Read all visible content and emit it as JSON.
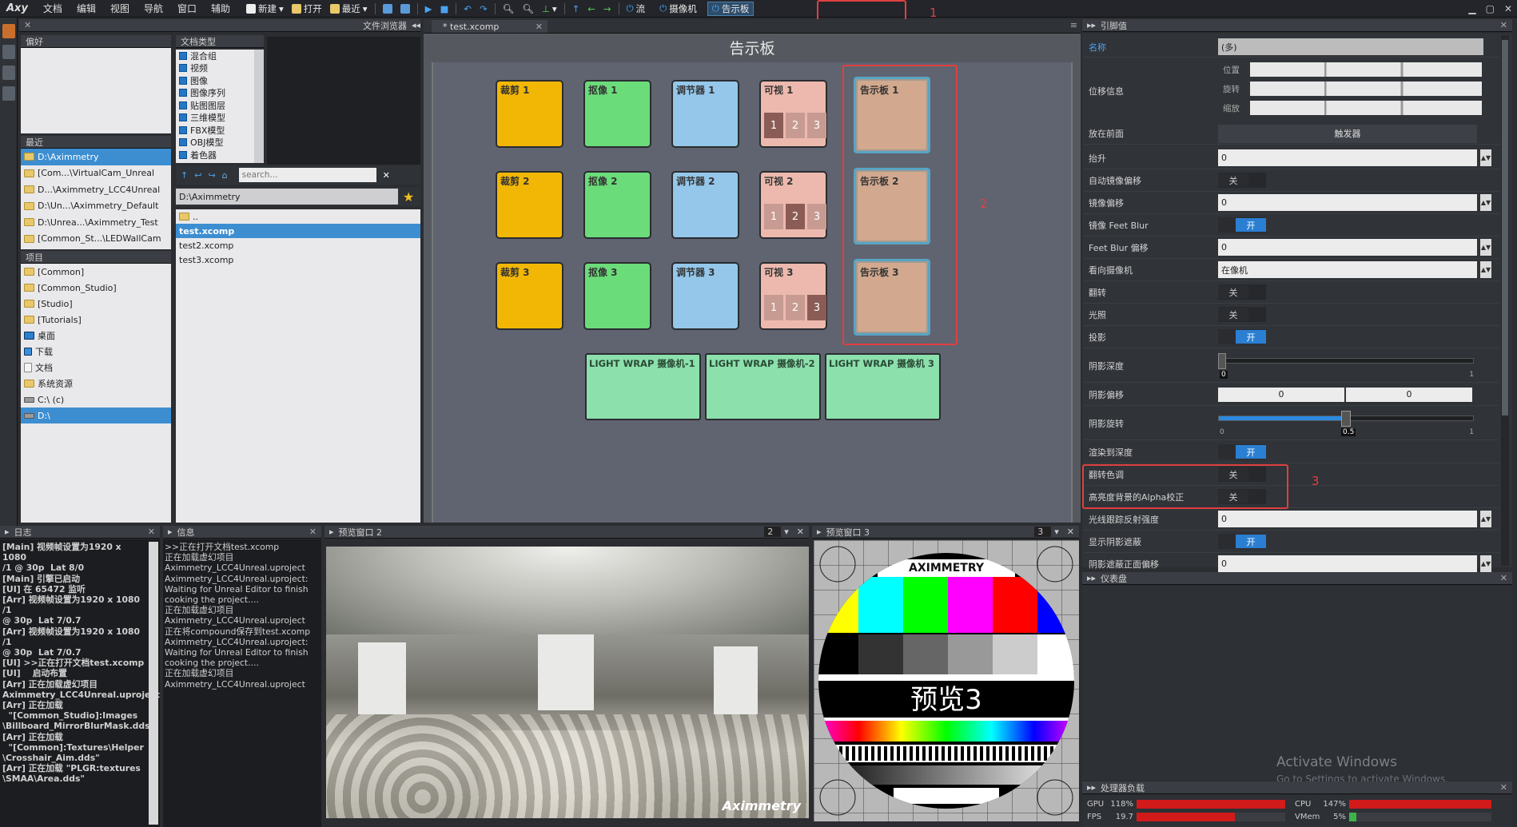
{
  "app": {
    "logo": "Axy"
  },
  "menu": [
    "文档",
    "编辑",
    "视图",
    "导航",
    "窗口",
    "辅助"
  ],
  "toolbar": {
    "new": "新建",
    "open": "打开",
    "recent": "最近",
    "flow": "流",
    "camera": "摄像机",
    "board": "告示板"
  },
  "file_browser": {
    "title": "文件浏览器",
    "favorites_label": "偏好",
    "doc_types_label": "文档类型",
    "doc_types": [
      "混合组",
      "视频",
      "图像",
      "图像序列",
      "贴图图层",
      "三维模型",
      "FBX模型",
      "OBJ模型",
      "着色器"
    ],
    "recent_label": "最近",
    "recent": [
      "D:\\Aximmetry",
      "[Com...\\VirtualCam_Unreal",
      "D...\\Aximmetry_LCC4Unreal",
      "D:\\Un...\\Aximmetry_Default",
      "D:\\Unrea...\\Aximmetry_Test",
      "[Common_St...\\LEDWallCam"
    ],
    "project_label": "项目",
    "project": [
      "[Common]",
      "[Common_Studio]",
      "[Studio]",
      "[Tutorials]",
      "桌面",
      "下载",
      "文档",
      "系统资源",
      "C:\\ (c)",
      "D:\\"
    ],
    "search_placeholder": "search...",
    "path": "D:\\Aximmetry",
    "files": [
      "..",
      "test.xcomp",
      "test2.xcomp",
      "test3.xcomp"
    ]
  },
  "editor": {
    "tab": "* test.xcomp",
    "title": "告示板",
    "groups": [
      {
        "label": "裁剪 1",
        "color": "#f2b705"
      },
      {
        "label": "抠像 1",
        "color": "#6bdc7a"
      },
      {
        "label": "调节器 1",
        "color": "#94c7ea"
      },
      {
        "label": "可视 1",
        "color": "#edb9ae"
      },
      {
        "label": "裁剪 2",
        "color": "#f2b705"
      },
      {
        "label": "抠像 2",
        "color": "#6bdc7a"
      },
      {
        "label": "调节器 2",
        "color": "#94c7ea"
      },
      {
        "label": "可视 2",
        "color": "#edb9ae"
      },
      {
        "label": "裁剪 3",
        "color": "#f2b705"
      },
      {
        "label": "抠像 3",
        "color": "#6bdc7a"
      },
      {
        "label": "调节器 3",
        "color": "#94c7ea"
      },
      {
        "label": "可视 3",
        "color": "#edb9ae"
      }
    ],
    "visible_tiles": [
      "1",
      "2",
      "3"
    ],
    "boards": [
      "告示板 1",
      "告示板 2",
      "告示板 3"
    ],
    "lightwrap": [
      "LIGHT WRAP 摄像机-1",
      "LIGHT WRAP 摄像机-2",
      "LIGHT WRAP 摄像机 3"
    ],
    "annotations": [
      "1",
      "2",
      "3"
    ]
  },
  "props": {
    "title": "引脚值",
    "name_label": "名称",
    "name_value": "(多)",
    "transform_label": "位移信息",
    "pos": "位置",
    "rot": "旋转",
    "scale": "缩放",
    "front_label": "放在前面",
    "trigger": "触发器",
    "rows": [
      {
        "label": "抬升",
        "value": "0"
      },
      {
        "label": "自动镜像偏移",
        "toggle": "关"
      },
      {
        "label": "镜像偏移",
        "value": "0"
      },
      {
        "label": "镜像 Feet Blur",
        "toggle": "开"
      },
      {
        "label": "Feet Blur 偏移",
        "value": "0"
      },
      {
        "label": "看向摄像机",
        "value": "在像机"
      },
      {
        "label": "翻转",
        "toggle": "关"
      },
      {
        "label": "光照",
        "toggle": "关"
      },
      {
        "label": "投影",
        "toggle": "开"
      }
    ],
    "shadow_depth_label": "阴影深度",
    "shadow_depth_min": "0",
    "shadow_depth_max": "1",
    "shadow_offset_label": "阴影偏移",
    "shadow_offset": [
      "0",
      "0"
    ],
    "shadow_rot_label": "阴影旋转",
    "shadow_rot_ticks": [
      "0",
      "0.5",
      "1"
    ],
    "shadow_rot_level": 0.5,
    "rows2": [
      {
        "label": "渲染到深度",
        "toggle": "开"
      },
      {
        "label": "翻转色调",
        "toggle": "关"
      },
      {
        "label": "高亮度背景的Alpha校正",
        "toggle": "关"
      },
      {
        "label": "光线跟踪反射强度",
        "value": "0"
      },
      {
        "label": "显示阴影遮蔽",
        "toggle": "开"
      },
      {
        "label": "阴影遮蔽正面偏移",
        "value": "0"
      }
    ]
  },
  "dashboard": {
    "title": "仪表盘",
    "watermark1": "Activate Windows",
    "watermark2": "Go to Settings to activate Windows."
  },
  "cpu": {
    "title": "处理器负载",
    "gpu_label": "GPU",
    "gpu_val": "118%",
    "gpu_level": 1.0,
    "cpu_label": "CPU",
    "cpu_val": "147%",
    "cpu_level": 1.0,
    "fps_label": "FPS",
    "fps_val": "19.7",
    "fps_level": 0.66,
    "vmem_label": "VMem",
    "vmem_val": "5%",
    "vmem_level": 0.05
  },
  "log": {
    "title": "日志",
    "text": "[Main] 视频帧设置为1920 x 1080\n/1 @ 30p  Lat 8/0\n[Main] 引擎已启动\n[UI] 在 65472 监听\n[Arr] 视频帧设置为1920 x 1080 /1\n@ 30p  Lat 7/0.7\n[Arr] 视频帧设置为1920 x 1080 /1\n@ 30p  Lat 7/0.7\n[UI] >>正在打开文档test.xcomp\n[UI]    启动布置\n[Arr] 正在加载虚幻项目\nAximmetry_LCC4Unreal.uproject\n[Arr] 正在加载\n  \"[Common_Studio]:Images\n\\Billboard_MirrorBlurMask.dds\"\n[Arr] 正在加载\n  \"[Common]:Textures\\Helper\n\\Crosshair_Aim.dds\"\n[Arr] 正在加载 \"PLGR:textures\n\\SMAA\\Area.dds\""
  },
  "info": {
    "title": "信息",
    "text": ">>正在打开文档test.xcomp\n正在加载虚幻项目\nAximmetry_LCC4Unreal.uproject\nAximmetry_LCC4Unreal.uproject:\nWaiting for Unreal Editor to finish\ncooking the project....\n正在加载虚幻项目\nAximmetry_LCC4Unreal.uproject\n正在将compound保存到test.xcomp\nAximmetry_LCC4Unreal.uproject:\nWaiting for Unreal Editor to finish\ncooking the project....\n正在加载虚幻项目\nAximmetry_LCC4Unreal.uproject"
  },
  "preview2": {
    "title": "预览窗口 2",
    "num": "2",
    "brand": "Aximmetry"
  },
  "preview3": {
    "title": "预览窗口 3",
    "num": "3",
    "brand": "AXIMMETRY",
    "label": "预览3"
  }
}
